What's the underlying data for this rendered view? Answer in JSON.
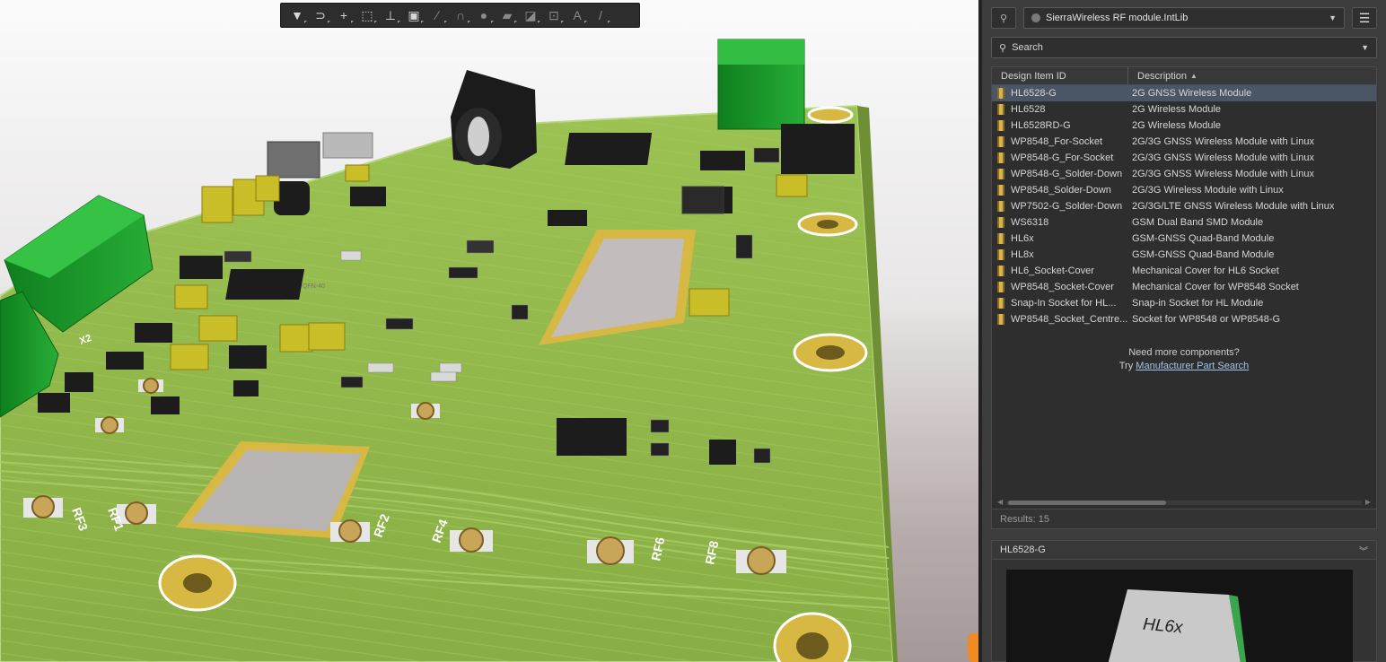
{
  "toolbar": {
    "tools": [
      {
        "name": "filter-icon",
        "glyph": "▼",
        "active": true
      },
      {
        "name": "interactive-route-icon",
        "glyph": "⊃"
      },
      {
        "name": "crosshair-icon",
        "glyph": "+"
      },
      {
        "name": "select-area-icon",
        "glyph": "⬚"
      },
      {
        "name": "align-icon",
        "glyph": "⊥"
      },
      {
        "name": "component-icon",
        "glyph": "▣"
      },
      {
        "name": "route-icon",
        "glyph": "∕"
      },
      {
        "name": "arc-icon",
        "glyph": "∩"
      },
      {
        "name": "place-via-icon",
        "glyph": "●"
      },
      {
        "name": "polygon-fill-icon",
        "glyph": "▰"
      },
      {
        "name": "region-icon",
        "glyph": "◪"
      },
      {
        "name": "dimension-icon",
        "glyph": "⊡"
      },
      {
        "name": "string-icon",
        "glyph": "A"
      },
      {
        "name": "line-icon",
        "glyph": "/"
      }
    ]
  },
  "board": {
    "silkscreen": [
      "RF3",
      "RF1",
      "RF2",
      "RF4",
      "RF6",
      "RF8",
      "X2"
    ],
    "ic_labels": [
      "QFN-40",
      "HL6x"
    ],
    "colors": {
      "board": "#8fb64a",
      "copper": "#d4b03e",
      "connector": "#1f9a2c",
      "chip": "#1c1c1c"
    }
  },
  "panel": {
    "library": "SierraWireless RF module.IntLib",
    "search_placeholder": "Search",
    "columns": {
      "id": "Design Item ID",
      "description": "Description"
    },
    "rows": [
      {
        "id": "HL6528-G",
        "description": "2G GNSS Wireless Module",
        "selected": true
      },
      {
        "id": "HL6528",
        "description": "2G Wireless Module"
      },
      {
        "id": "HL6528RD-G",
        "description": "2G Wireless Module"
      },
      {
        "id": "WP8548_For-Socket",
        "description": "2G/3G GNSS Wireless Module with Linux"
      },
      {
        "id": "WP8548-G_For-Socket",
        "description": "2G/3G GNSS Wireless Module with Linux"
      },
      {
        "id": "WP8548-G_Solder-Down",
        "description": "2G/3G GNSS Wireless Module with Linux"
      },
      {
        "id": "WP8548_Solder-Down",
        "description": "2G/3G Wireless Module with Linux"
      },
      {
        "id": "WP7502-G_Solder-Down",
        "description": "2G/3G/LTE GNSS Wireless Module with Linux"
      },
      {
        "id": "WS6318",
        "description": "GSM Dual Band SMD Module"
      },
      {
        "id": "HL6x",
        "description": "GSM-GNSS Quad-Band Module"
      },
      {
        "id": "HL8x",
        "description": "GSM-GNSS Quad-Band Module"
      },
      {
        "id": "HL6_Socket-Cover",
        "description": "Mechanical Cover for HL6 Socket"
      },
      {
        "id": "WP8548_Socket-Cover",
        "description": "Mechanical Cover for WP8548 Socket"
      },
      {
        "id": "Snap-In Socket for HL...",
        "description": "Snap-in Socket for HL Module"
      },
      {
        "id": "WP8548_Socket_Centre...",
        "description": "Socket for WP8548 or WP8548-G"
      }
    ],
    "more_text": "Need more components?",
    "try_text": "Try",
    "more_link": "Manufacturer Part Search",
    "results": "Results: 15",
    "preview_title": "HL6528-G",
    "preview_chip_label": "HL6x"
  }
}
